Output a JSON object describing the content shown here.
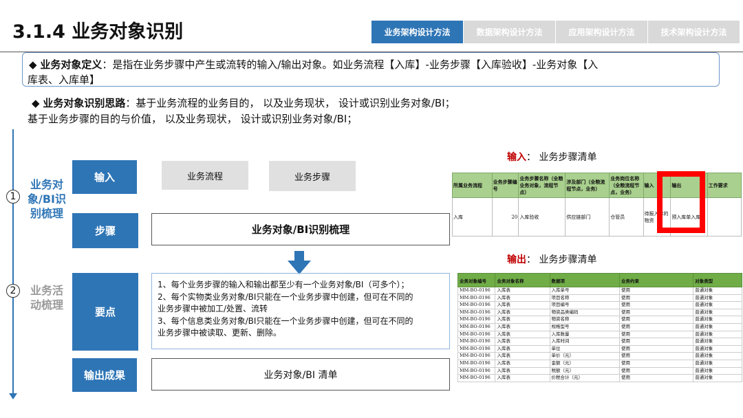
{
  "title": "3.1.4 业务对象识别",
  "tabs": [
    {
      "label": "业务架构设计方法",
      "active": true
    },
    {
      "label": "数据架构设计方法",
      "active": false
    },
    {
      "label": "应用架构设计方法",
      "active": false
    },
    {
      "label": "技术架构设计方法",
      "active": false
    }
  ],
  "definition": {
    "bullet": "◆",
    "bold": "业务对象定义",
    "text1": "：是指在业务步骤中产生或流转的输入/输出对象。如业务流程【入库】-业务步骤【入库验收】-业务对象【入",
    "text2": "库表、入库单】"
  },
  "approach": {
    "bullet": "◆",
    "bold": "业务对象识别思路",
    "text1": "：基于业务流程的业务目的， 以及业务现状， 设计或识别业务对象/BI；",
    "text2": "基于业务步骤的目的与价值， 以及业务现状， 设计或识别业务对象/BI；"
  },
  "sections": [
    {
      "num": "1",
      "label": "业务对象/BI识别梳理"
    },
    {
      "num": "2",
      "label": "业务活动梳理"
    }
  ],
  "sections_display": {
    "s1": [
      "业务对",
      "象/BI识",
      "别梳理"
    ],
    "s2": [
      "业务活",
      "动梳理"
    ]
  },
  "rows": {
    "input_label": "输入",
    "input_items": [
      "业务流程",
      "业务步骤"
    ],
    "step_label": "步骤",
    "step_text": "业务对象/BI识别梳理",
    "points_label": "要点",
    "points": [
      "1、每个业务步骤的输入和输出都至少有一个业务对象/BI（可多个）；",
      "2、每个实物类业务对象/BI只能在一个业务步骤中创建，但可在不同的",
      "业务步骤中被加工/处置、流转",
      "3、每个信息类业务对象/BI只能在一个业务步骤中创建，但可在不同的",
      "业务步骤中被读取、更新、删除。"
    ],
    "output_label": "输出成果",
    "output_text": "业务对象/BI 清单"
  },
  "input_table": {
    "caption_red": "输入",
    "caption_rest": "： 业务步骤清单",
    "headers": [
      "所属业务流程",
      "业务步骤编号",
      "业务步骤名称（全粮业务对象，流程节点）",
      "涉及部门（全粮流程节点，业务）",
      "业务岗位名称（全粮流程节点，业务）",
      "输入",
      "输出",
      "工作要求"
    ],
    "row": [
      "入库",
      "20",
      "入库验收",
      "供应链部门",
      "仓管员",
      "待报入库的物资",
      "预入库单入库表",
      ""
    ]
  },
  "output_table": {
    "caption_red": "输出",
    "caption_rest": "： 业务步骤清单",
    "headers": [
      "业务对象编号",
      "业务对象名称",
      "数据项",
      "业务约束",
      "对象类型"
    ],
    "rows": [
      [
        "MM-BO-0196",
        "入库表",
        "入库单号",
        "使用",
        "普通对象"
      ],
      [
        "MM-BO-0196",
        "入库表",
        "项目名称",
        "使用",
        "普通对象"
      ],
      [
        "MM-BO-0196",
        "入库表",
        "项目编号",
        "使用",
        "普通对象"
      ],
      [
        "MM-BO-0196",
        "入库表",
        "物资品类编码",
        "使用",
        "普通对象"
      ],
      [
        "MM-BO-0196",
        "入库表",
        "物资名称",
        "使用",
        "普通对象"
      ],
      [
        "MM-BO-0196",
        "入库表",
        "规格型号",
        "使用",
        "普通对象"
      ],
      [
        "MM-BO-0196",
        "入库表",
        "入库数量",
        "使用",
        "普通对象"
      ],
      [
        "MM-BO-0196",
        "入库表",
        "入库时间",
        "使用",
        "普通对象"
      ],
      [
        "MM-BO-0196",
        "入库表",
        "单位",
        "使用",
        "普通对象"
      ],
      [
        "MM-BO-0196",
        "入库表",
        "单价（元）",
        "使用",
        "普通对象"
      ],
      [
        "MM-BO-0196",
        "入库表",
        "金额（元）",
        "使用",
        "普通对象"
      ],
      [
        "MM-BO-0196",
        "入库表",
        "税额（元）",
        "使用",
        "普通对象"
      ],
      [
        "MM-BO-0196",
        "入库表",
        "价税合计（元）",
        "使用",
        "普通对象"
      ]
    ]
  },
  "colors": {
    "accent": "#2e75b6",
    "highlight": "#ff0000",
    "header_green": "#70ad47"
  }
}
